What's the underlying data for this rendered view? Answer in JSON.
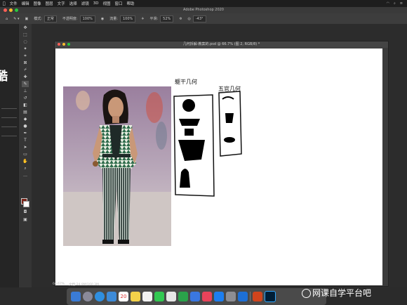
{
  "menubar": {
    "items": [
      "文件",
      "编辑",
      "图像",
      "图层",
      "文字",
      "选择",
      "滤镜",
      "3D",
      "视图",
      "窗口",
      "帮助"
    ]
  },
  "app_title": "Adobe Photoshop 2020",
  "options": {
    "mode_label": "模式:",
    "mode_value": "正常",
    "opacity_label": "不透明度:",
    "opacity_value": "100%",
    "flow_label": "流量:",
    "flow_value": "100%",
    "smooth_label": "平滑:",
    "smooth_value": "52%",
    "angle_value": "-43°"
  },
  "document": {
    "title": "几何拆解-教案的.psd @ 66.7% (图 2, RGB/8) *",
    "zoom": "66.67%",
    "docsize": "文档:24.9M/160.3M"
  },
  "left_panel": {
    "big_text": "酷"
  },
  "sketch": {
    "label1": "躯干几何",
    "label2": "五官几何"
  },
  "watermark": "网课自学平台吧",
  "dock": {
    "calendar_day": "20"
  },
  "colors": {
    "foreground": "#7b2418",
    "background": "#ffffff"
  }
}
